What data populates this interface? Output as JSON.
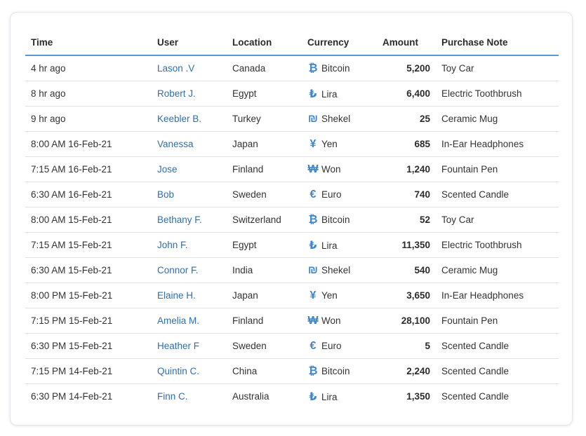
{
  "colors": {
    "accent": "#5b9bd5",
    "link": "#2f6fb0",
    "icon": "#3f86cf"
  },
  "headers": {
    "time": "Time",
    "user": "User",
    "location": "Location",
    "currency": "Currency",
    "amount": "Amount",
    "note": "Purchase Note"
  },
  "rows": [
    {
      "time": "4 hr ago",
      "user": "Lason .V",
      "location": "Canada",
      "currency": "Bitcoin",
      "currency_icon": "bitcoin-icon",
      "symbol": "₿",
      "amount": "5,200",
      "note": "Toy Car"
    },
    {
      "time": "8 hr ago",
      "user": "Robert J.",
      "location": "Egypt",
      "currency": "Lira",
      "currency_icon": "lira-icon",
      "symbol": "₺",
      "amount": "6,400",
      "note": "Electric Toothbrush"
    },
    {
      "time": "9 hr ago",
      "user": "Keebler B.",
      "location": "Turkey",
      "currency": "Shekel",
      "currency_icon": "shekel-icon",
      "symbol": "₪",
      "amount": "25",
      "note": "Ceramic Mug"
    },
    {
      "time": "8:00 AM 16-Feb-21",
      "user": "Vanessa",
      "location": "Japan",
      "currency": "Yen",
      "currency_icon": "yen-icon",
      "symbol": "¥",
      "amount": "685",
      "note": "In-Ear Headphones"
    },
    {
      "time": "7:15 AM 16-Feb-21",
      "user": "Jose",
      "location": "Finland",
      "currency": "Won",
      "currency_icon": "won-icon",
      "symbol": "₩",
      "amount": "1,240",
      "note": "Fountain Pen"
    },
    {
      "time": "6:30 AM 16-Feb-21",
      "user": "Bob",
      "location": "Sweden",
      "currency": "Euro",
      "currency_icon": "euro-icon",
      "symbol": "€",
      "amount": "740",
      "note": "Scented Candle"
    },
    {
      "time": "8:00 AM 15-Feb-21",
      "user": "Bethany F.",
      "location": "Switzerland",
      "currency": "Bitcoin",
      "currency_icon": "bitcoin-icon",
      "symbol": "₿",
      "amount": "52",
      "note": "Toy Car"
    },
    {
      "time": "7:15 AM 15-Feb-21",
      "user": "John F.",
      "location": "Egypt",
      "currency": "Lira",
      "currency_icon": "lira-icon",
      "symbol": "₺",
      "amount": "11,350",
      "note": "Electric Toothbrush"
    },
    {
      "time": "6:30 AM 15-Feb-21",
      "user": "Connor F.",
      "location": "India",
      "currency": "Shekel",
      "currency_icon": "shekel-icon",
      "symbol": "₪",
      "amount": "540",
      "note": "Ceramic Mug"
    },
    {
      "time": "8:00 PM 15-Feb-21",
      "user": "Elaine H.",
      "location": "Japan",
      "currency": "Yen",
      "currency_icon": "yen-icon",
      "symbol": "¥",
      "amount": "3,650",
      "note": "In-Ear Headphones"
    },
    {
      "time": "7:15 PM 15-Feb-21",
      "user": "Amelia M.",
      "location": "Finland",
      "currency": "Won",
      "currency_icon": "won-icon",
      "symbol": "₩",
      "amount": "28,100",
      "note": "Fountain Pen"
    },
    {
      "time": "6:30 PM 15-Feb-21",
      "user": "Heather F",
      "location": "Sweden",
      "currency": "Euro",
      "currency_icon": "euro-icon",
      "symbol": "€",
      "amount": "5",
      "note": "Scented Candle"
    },
    {
      "time": "7:15 PM 14-Feb-21",
      "user": "Quintin C.",
      "location": "China",
      "currency": "Bitcoin",
      "currency_icon": "bitcoin-icon",
      "symbol": "₿",
      "amount": "2,240",
      "note": "Scented Candle"
    },
    {
      "time": "6:30 PM 14-Feb-21",
      "user": "Finn C.",
      "location": "Australia",
      "currency": "Lira",
      "currency_icon": "lira-icon",
      "symbol": "₺",
      "amount": "1,350",
      "note": "Scented Candle"
    }
  ]
}
